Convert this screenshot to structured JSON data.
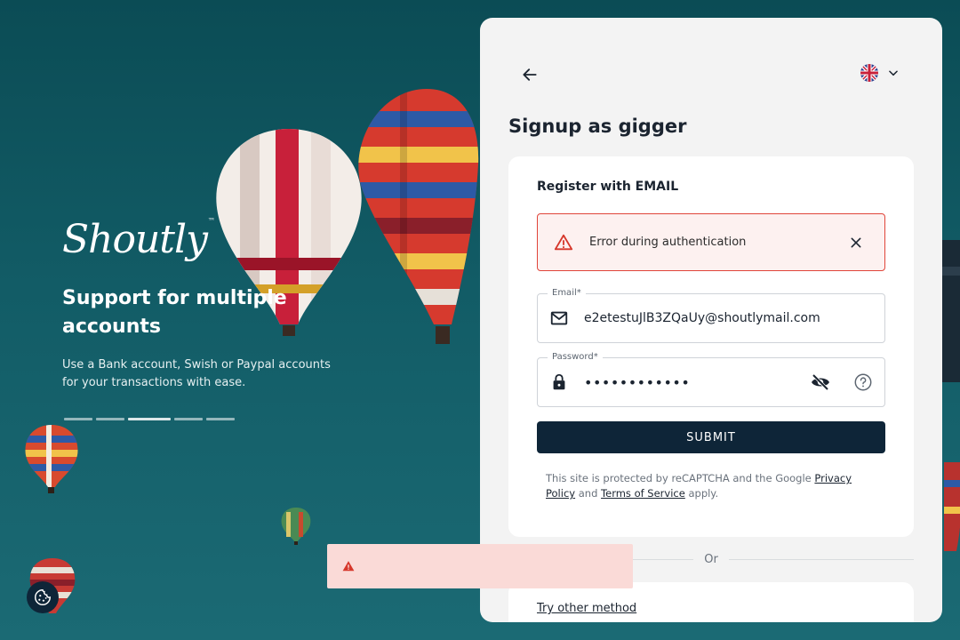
{
  "brand": {
    "logo_text": "Shoutly",
    "trademark": "™"
  },
  "hero": {
    "title": "Support for multiple accounts",
    "description": "Use a Bank account, Swish or Paypal accounts for your transactions with ease.",
    "carousel": {
      "total": 5,
      "active_index": 2
    }
  },
  "header": {
    "language": "English (UK)"
  },
  "page": {
    "title": "Signup as gigger"
  },
  "form": {
    "heading": "Register with EMAIL",
    "error": {
      "message": "Error during authentication"
    },
    "email": {
      "label": "Email*",
      "value": "e2etestuJlB3ZQaUy@shoutlymail.com"
    },
    "password": {
      "label": "Password*",
      "masked_value": "••••••••••••"
    },
    "submit_label": "SUBMIT",
    "recaptcha": {
      "prefix": "This site is protected by reCAPTCHA and the Google ",
      "privacy_link": "Privacy Policy",
      "middle": " and ",
      "terms_link": "Terms of Service",
      "suffix": " apply."
    }
  },
  "divider_text": "Or",
  "alt": {
    "link_label": "Try other method"
  },
  "colors": {
    "primary": "#0e2538",
    "error": "#e0453a",
    "error_bg": "#fdf1f0",
    "toast_bg": "#fadad7"
  }
}
